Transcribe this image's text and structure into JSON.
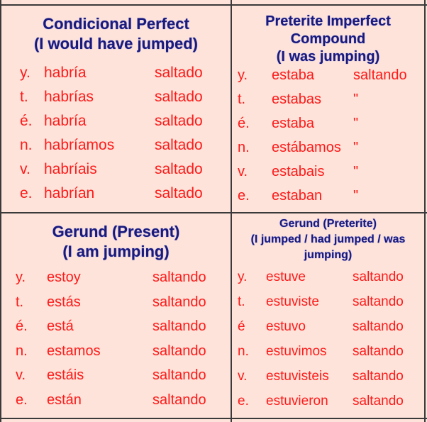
{
  "colors": {
    "background": "#fde3d9",
    "heading": "#1a1a7a",
    "conjugation": "#ff1a1a",
    "border": "#3a3a3a"
  },
  "cells": [
    {
      "title_lines": [
        "Condicional Perfect",
        "(I would have jumped)"
      ],
      "rows": [
        {
          "pronoun": "y.",
          "aux": "habría",
          "verb": "saltado"
        },
        {
          "pronoun": "t.",
          "aux": "habrías",
          "verb": "saltado"
        },
        {
          "pronoun": "é.",
          "aux": "habría",
          "verb": "saltado"
        },
        {
          "pronoun": "n.",
          "aux": "habríamos",
          "verb": "saltado"
        },
        {
          "pronoun": "v.",
          "aux": "habríais",
          "verb": "saltado"
        },
        {
          "pronoun": "e.",
          "aux": "habrían",
          "verb": "saltado"
        }
      ]
    },
    {
      "title_lines": [
        "Preterite Imperfect",
        "Compound",
        "(I was jumping)"
      ],
      "rows": [
        {
          "pronoun": "y.",
          "aux": "estaba",
          "verb": "saltando"
        },
        {
          "pronoun": "t.",
          "aux": "estabas",
          "verb": "\""
        },
        {
          "pronoun": "é.",
          "aux": "estaba",
          "verb": "\""
        },
        {
          "pronoun": "n.",
          "aux": "estábamos",
          "verb": "\""
        },
        {
          "pronoun": "v.",
          "aux": "estabais",
          "verb": "\""
        },
        {
          "pronoun": "e.",
          "aux": "estaban",
          "verb": "\""
        }
      ]
    },
    {
      "title_lines": [
        "Gerund (Present)",
        "(I am jumping)"
      ],
      "rows": [
        {
          "pronoun": "y.",
          "aux": "estoy",
          "verb": "saltando"
        },
        {
          "pronoun": "t.",
          "aux": "estás",
          "verb": "saltando"
        },
        {
          "pronoun": "é.",
          "aux": "está",
          "verb": "saltando"
        },
        {
          "pronoun": "n.",
          "aux": "estamos",
          "verb": "saltando"
        },
        {
          "pronoun": "v.",
          "aux": "estáis",
          "verb": "saltando"
        },
        {
          "pronoun": "e.",
          "aux": "están",
          "verb": "saltando"
        }
      ]
    },
    {
      "title_lines": [
        "Gerund (Preterite)",
        "(I jumped / had jumped / was",
        "jumping)"
      ],
      "rows": [
        {
          "pronoun": "y.",
          "aux": "estuve",
          "verb": "saltando"
        },
        {
          "pronoun": "t.",
          "aux": "estuviste",
          "verb": "saltando"
        },
        {
          "pronoun": "é",
          "aux": "estuvo",
          "verb": "saltando"
        },
        {
          "pronoun": "n.",
          "aux": "estuvimos",
          "verb": "saltando"
        },
        {
          "pronoun": "v.",
          "aux": "estuvisteis",
          "verb": "saltando"
        },
        {
          "pronoun": "e.",
          "aux": "estuvieron",
          "verb": "saltando"
        }
      ]
    }
  ]
}
